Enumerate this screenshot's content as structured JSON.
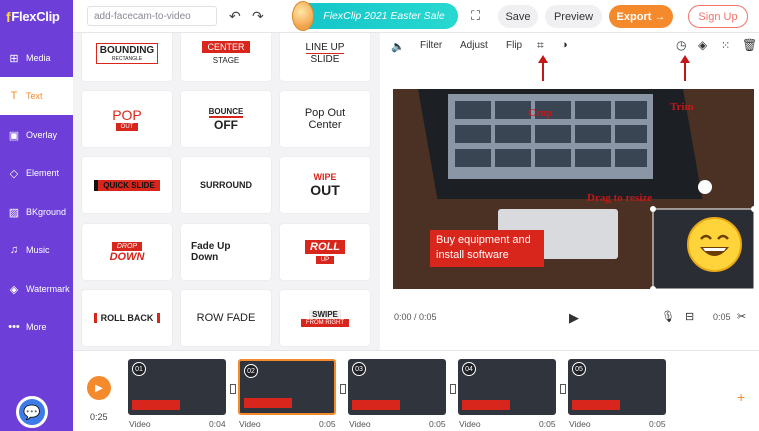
{
  "app": {
    "logo": "FlexClip"
  },
  "topbar": {
    "project_name": "add-facecam-to-video",
    "promo": "FlexClip 2021 Easter Sale",
    "save_label": "Save",
    "preview_label": "Preview",
    "export_label": "Export →",
    "signup_label": "Sign Up"
  },
  "sidebar": {
    "items": [
      {
        "label": "Media",
        "icon": "media-icon"
      },
      {
        "label": "Text",
        "icon": "text-icon"
      },
      {
        "label": "Overlay",
        "icon": "overlay-icon"
      },
      {
        "label": "Element",
        "icon": "element-icon"
      },
      {
        "label": "BKground",
        "icon": "background-icon"
      },
      {
        "label": "Music",
        "icon": "music-icon"
      },
      {
        "label": "Watermark",
        "icon": "watermark-icon"
      },
      {
        "label": "More",
        "icon": "more-icon"
      }
    ]
  },
  "templates": {
    "t1_a": "BOUNDING",
    "t1_b": "RECTANGLE",
    "t2_a": "CENTER",
    "t2_b": "STAGE",
    "t3_a": "LINE UP",
    "t3_b": "SLIDE",
    "t4_a": "POP",
    "t4_b": "OUT",
    "t5_a": "BOUNCE",
    "t5_b": "OFF",
    "t6_a": "Pop Out",
    "t6_b": "Center",
    "t7_a": "QUICK SLIDE",
    "t8_a": "SURROUND",
    "t9_a": "WIPE",
    "t9_b": "OUT",
    "t10_a": "DROP",
    "t10_b": "DOWN",
    "t11_a": "Fade Up",
    "t11_b": "Down",
    "t12_a": "ROLL",
    "t12_b": "UP",
    "t13_a": "ROLL BACK",
    "t14_a": "ROW FADE",
    "t15_a": "SWIPE",
    "t15_b": "FROM RIGHT"
  },
  "editor": {
    "toolbar": {
      "filter": "Filter",
      "adjust": "Adjust",
      "flip": "Flip"
    },
    "caption": "Buy equipment and install software",
    "annotations": {
      "crop": "Crop",
      "trim": "Trim",
      "drag": "Drag to resize"
    },
    "time_current": "0:00 / 0:05",
    "time_end": "0:05"
  },
  "timeline": {
    "duration": "0:25",
    "clips": [
      {
        "num": "01",
        "label": "Video",
        "dur": "0:04"
      },
      {
        "num": "02",
        "label": "Video",
        "dur": "0:05"
      },
      {
        "num": "03",
        "label": "Video",
        "dur": "0:05"
      },
      {
        "num": "04",
        "label": "Video",
        "dur": "0:05"
      },
      {
        "num": "05",
        "label": "Video",
        "dur": "0:05"
      }
    ]
  },
  "colors": {
    "brand": "#6d3fd8",
    "accent": "#f58a2c",
    "title_red": "#d9261c",
    "annotation": "#c41818"
  }
}
